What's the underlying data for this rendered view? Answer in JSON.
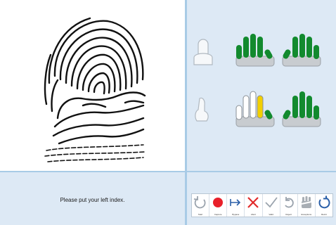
{
  "prompt": {
    "text": "Please put your left index."
  },
  "toolbar": {
    "buttons": [
      {
        "id": "start",
        "label": "Start",
        "icon": "restart-icon"
      },
      {
        "id": "capture",
        "label": "Capture",
        "icon": "record-icon"
      },
      {
        "id": "bypass",
        "label": "Bypass",
        "icon": "bypass-icon"
      },
      {
        "id": "abort",
        "label": "Abort",
        "icon": "abort-icon"
      },
      {
        "id": "valid",
        "label": "Valid",
        "icon": "check-icon"
      },
      {
        "id": "reject",
        "label": "Reject",
        "icon": "undo-icon"
      },
      {
        "id": "exceptions",
        "label": "Exceptions",
        "icon": "bandaged-hand-icon"
      },
      {
        "id": "reinit",
        "label": "Reinit",
        "icon": "refresh-icon"
      }
    ]
  },
  "colors": {
    "panel_bg": "#dde9f5",
    "divider": "#a8cbe6",
    "finger_captured": "#128a2e",
    "finger_current": "#f2cf00",
    "finger_pending": "#ffffff",
    "palm": "#c8ccd0",
    "capture_red": "#e8202a",
    "abort_red": "#e02a2a",
    "refresh_blue": "#2a5fa8"
  },
  "hands": {
    "row1": {
      "left": [
        "captured",
        "captured",
        "captured",
        "captured",
        "captured"
      ],
      "right": [
        "captured",
        "captured",
        "captured",
        "captured",
        "captured"
      ]
    },
    "row2": {
      "left": [
        "pending",
        "pending",
        "pending",
        "current",
        "captured"
      ],
      "right": [
        "captured",
        "captured",
        "captured",
        "captured",
        "captured"
      ]
    }
  }
}
